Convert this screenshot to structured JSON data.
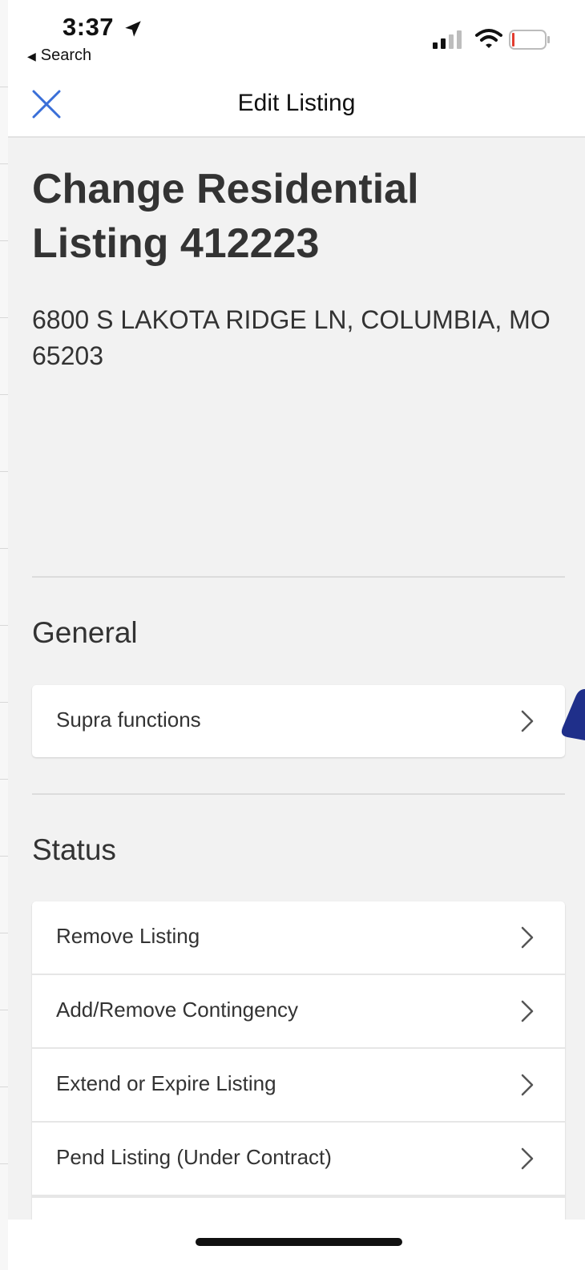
{
  "status_bar": {
    "time": "3:37",
    "back_label": "Search",
    "icons": [
      "location-arrow-icon",
      "signal-icon",
      "wifi-icon",
      "battery-icon"
    ]
  },
  "nav": {
    "title": "Edit Listing",
    "close_icon": "close-icon"
  },
  "listing": {
    "title": "Change Residential Listing 412223",
    "address": "6800 S LAKOTA RIDGE LN, COLUMBIA, MO 65203"
  },
  "sections": [
    {
      "title": "General",
      "items": [
        {
          "label": "Supra functions"
        }
      ]
    },
    {
      "title": "Status",
      "items": [
        {
          "label": "Remove Listing"
        },
        {
          "label": "Add/Remove Contingency"
        },
        {
          "label": "Extend or Expire Listing"
        },
        {
          "label": "Pend Listing (Under Contract)"
        }
      ]
    }
  ],
  "colors": {
    "accent": "#3a6fd8",
    "background": "#f2f2f2",
    "card": "#ffffff",
    "text": "#333333",
    "pointer": "#1f2f8a"
  }
}
